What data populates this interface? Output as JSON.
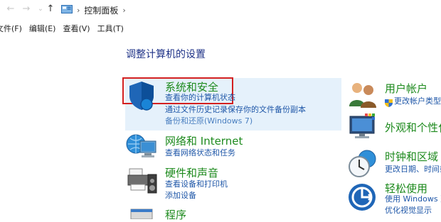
{
  "addressbar": {
    "back_icon": "arrow-left-icon",
    "forward_icon": "arrow-right-icon",
    "up_icon": "arrow-up-icon",
    "crumb": "控制面板"
  },
  "menubar": {
    "items": [
      "文件(F)",
      "编辑(E)",
      "查看(V)",
      "工具(T)"
    ]
  },
  "main": {
    "title": "调整计算机的设置"
  },
  "categories_left": [
    {
      "title": "系统和安全",
      "links": [
        "查看你的计算机状态",
        "通过文件历史记录保存你的文件备份副本",
        "备份和还原(Windows 7)"
      ]
    },
    {
      "title": "网络和 Internet",
      "links": [
        "查看网络状态和任务"
      ]
    },
    {
      "title": "硬件和声音",
      "links": [
        "查看设备和打印机",
        "添加设备"
      ]
    },
    {
      "title": "程序",
      "links": []
    }
  ],
  "categories_right": [
    {
      "title": "用户帐户",
      "links": [
        "更改帐户类型"
      ]
    },
    {
      "title": "外观和个性化",
      "links": []
    },
    {
      "title": "时钟和区域",
      "links": [
        "更改日期、时间或"
      ]
    },
    {
      "title": "轻松使用",
      "links": [
        "使用 Windows 建议",
        "优化视觉显示"
      ]
    }
  ],
  "colors": {
    "category_green": "#1d8a1d",
    "link_blue": "#1f57a8",
    "highlight": "#e5f1fb",
    "focus_red": "#d32020"
  }
}
